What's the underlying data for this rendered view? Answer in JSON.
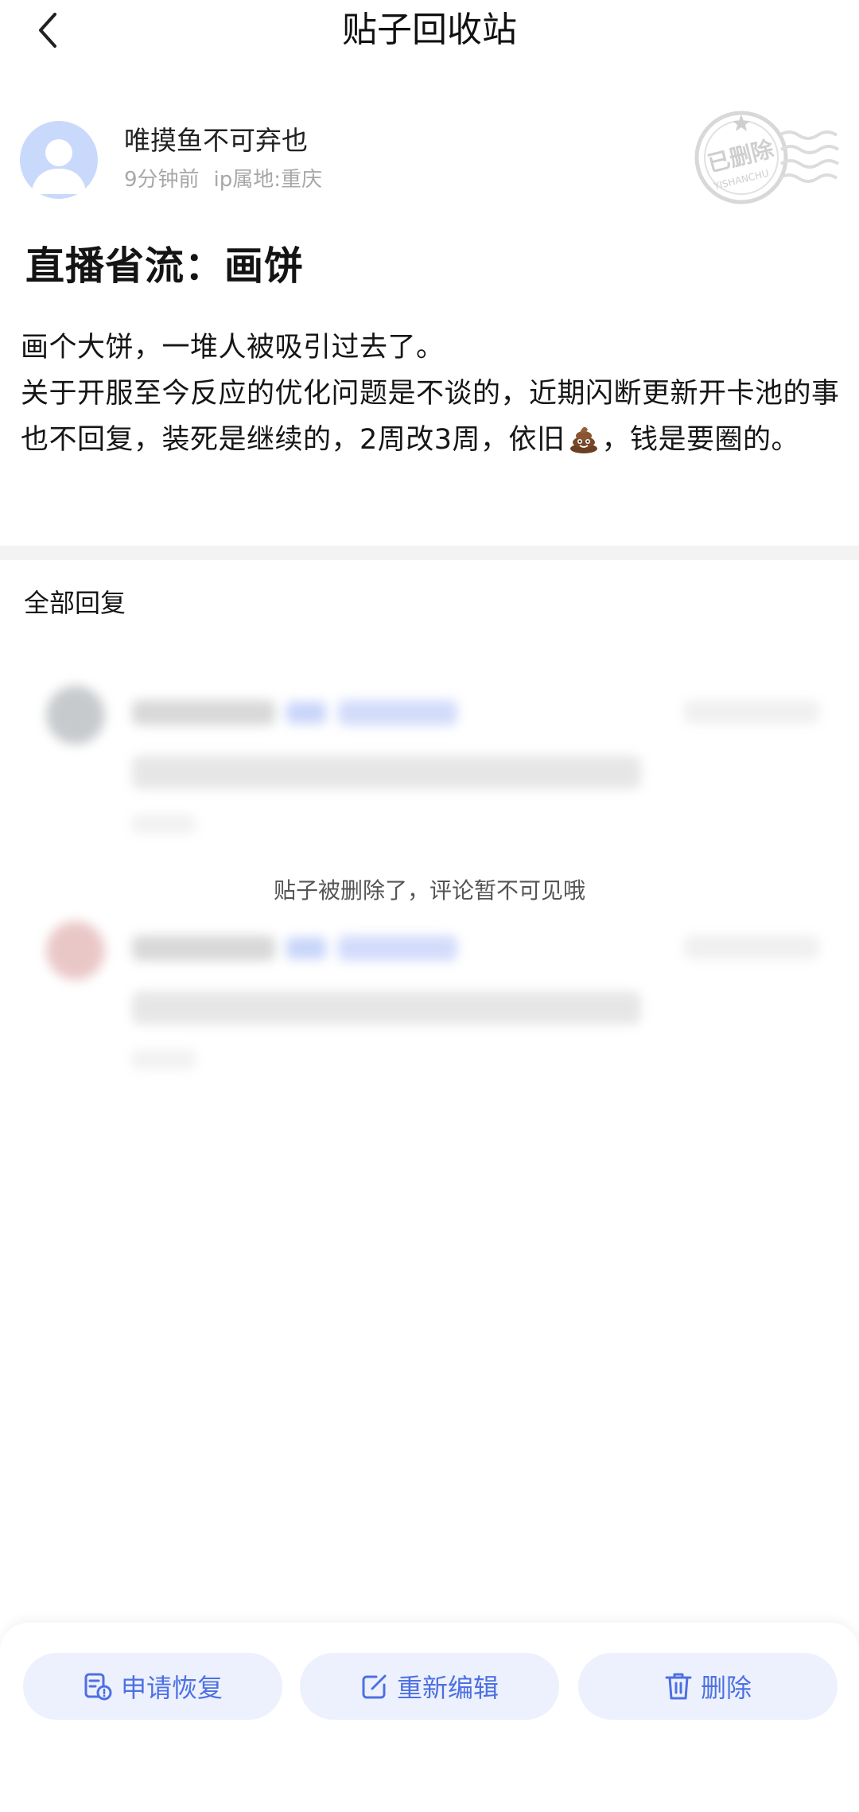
{
  "header": {
    "title": "贴子回收站",
    "back_icon": "chevron-left-icon"
  },
  "post": {
    "author": "唯摸鱼不可弃也",
    "time": "9分钟前",
    "ip_location": "ip属地:重庆",
    "stamp": {
      "text_main": "已删除",
      "text_sub": "YISHANCHU"
    },
    "title": "直播省流：画饼",
    "body": {
      "line1": "画个大饼，一堆人被吸引过去了。",
      "line2_before_emoji": "关于开服至今反应的优化问题是不谈的，近期闪断更新开卡池的事也不回复，装死是继续的，2周改3周，依旧",
      "emoji": "poop-emoji",
      "line2_after_emoji": "，钱是要圈的。"
    }
  },
  "replies": {
    "title": "全部回复",
    "deleted_notice": "贴子被删除了，评论暂不可见哦"
  },
  "actions": {
    "restore_label": "申请恢复",
    "edit_label": "重新编辑",
    "delete_label": "删除"
  },
  "colors": {
    "accent": "#4d70e2",
    "button_bg": "#edf1fe",
    "avatar_bg": "#c9d9fb",
    "meta_text": "#a8a8a8"
  }
}
